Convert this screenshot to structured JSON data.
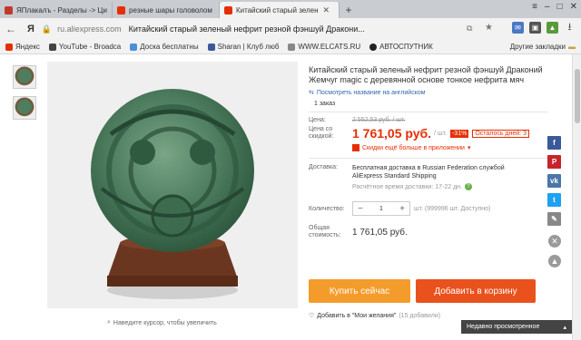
{
  "tabs": [
    {
      "label": "ЯПлакалъ - Разделы -> Ци"
    },
    {
      "label": "резные шары головолом"
    },
    {
      "label": "Китайский старый зелен"
    }
  ],
  "new_tab_label": "+",
  "browser": {
    "yandex_label": "Я",
    "url_domain": "ru.aliexpress.com",
    "page_title": "Китайский старый зеленый нефрит резной фэншуй Дракони..."
  },
  "bookmarks": [
    {
      "label": "Яндекс"
    },
    {
      "label": "YouTube - Broadca"
    },
    {
      "label": "Доска бесплатны"
    },
    {
      "label": "Sharan | Клуб люб"
    },
    {
      "label": "WWW.ELCATS.RU"
    },
    {
      "label": "АВТОСПУТНИК"
    },
    {
      "label": "Другие закладки"
    }
  ],
  "product": {
    "title": "Китайский старый зеленый нефрит резной фэншуй Драконий Жемчуг magic с деревянной основе тонкое нефрита мяч",
    "translate_link": "Посмотреть название на английском",
    "orders": "1 заказ",
    "price_label": "Цена:",
    "old_price": "2 552,53 руб. / шт.",
    "discount_label": "Цена со скидкой:",
    "price": "1 761,05 руб.",
    "price_unit": "/ шт.",
    "discount_pct": "-31%",
    "days_left": "Осталось дней: 3",
    "app_discount": "Скидки ещё больше в приложении",
    "shipping_label": "Доставка:",
    "shipping_text": "Бесплатная доставка в Russian Federation службой AliExpress Standard Shipping",
    "delivery_time": "Расчётное время доставки: 17-22 дн.",
    "qty_label": "Количество:",
    "qty_value": "1",
    "qty_unit": "шт. (999996 шт. Доступно)",
    "total_label": "Общая стоимость:",
    "total": "1 761,05 руб.",
    "buy_now": "Купить сейчас",
    "add_to_cart": "Добавить в корзину",
    "wishlist": "Добавить в \"Мои желания\"",
    "wishlist_count": "(15 добавили)"
  },
  "zoom_hint": "Наведите курсор, чтобы увеличить",
  "recently_viewed": "Недавно просмотренное",
  "colors": {
    "accent": "#e62e04",
    "buy_button": "#f49c2b",
    "cart_button": "#e9511d"
  }
}
